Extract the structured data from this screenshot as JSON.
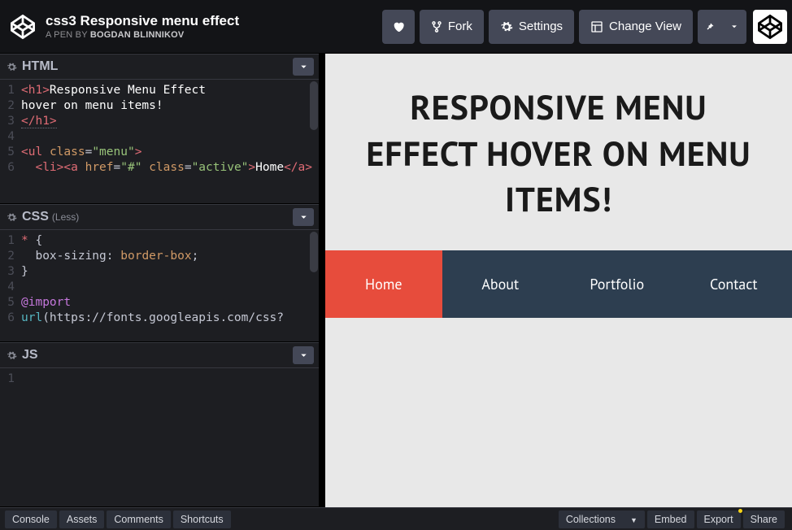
{
  "header": {
    "title": "css3 Responsive menu effect",
    "byline_prefix": "A PEN BY",
    "author": "Bogdan Blinnikov",
    "buttons": {
      "fork": "Fork",
      "settings": "Settings",
      "change_view": "Change View"
    }
  },
  "editors": {
    "html": {
      "title": "HTML",
      "lines": [
        {
          "n": "1",
          "html": "<span class='t-tag'>&lt;h1&gt;</span><span class='t-text'>Responsive Menu Effect</span>"
        },
        {
          "n": "2",
          "html": "<span class='t-text'>hover on menu items!</span>"
        },
        {
          "n": "3",
          "html": "<span class='t-tag t-close'>&lt;/h1&gt;</span>"
        },
        {
          "n": "4",
          "html": ""
        },
        {
          "n": "5",
          "html": "<span class='t-tag'>&lt;ul</span> <span class='t-attr'>class</span>=<span class='t-str'>\"menu\"</span><span class='t-tag'>&gt;</span>"
        },
        {
          "n": "6",
          "html": "  <span class='t-tag'>&lt;li&gt;&lt;a</span> <span class='t-attr'>href</span>=<span class='t-str'>\"#\"</span> <span class='t-attr'>class</span>=<span class='t-str'>\"active\"</span><span class='t-tag'>&gt;</span><span class='t-text'>Home</span><span class='t-tag'>&lt;/a&gt;</span>"
        }
      ]
    },
    "css": {
      "title": "CSS",
      "subtitle": "(Less)",
      "lines": [
        {
          "n": "1",
          "html": "<span class='t-tag'>*</span> {"
        },
        {
          "n": "2",
          "html": "  <span class='t-prop'>box-sizing</span>: <span class='t-val'>border-box</span>;"
        },
        {
          "n": "3",
          "html": "}"
        },
        {
          "n": "4",
          "html": ""
        },
        {
          "n": "5",
          "html": "<span class='t-key'>@import</span>"
        },
        {
          "n": "6",
          "html": "<span class='t-url'>url</span>(https://fonts.googleapis.com/css?"
        }
      ]
    },
    "js": {
      "title": "JS",
      "lines": [
        {
          "n": "1",
          "html": ""
        }
      ]
    }
  },
  "preview": {
    "heading": "RESPONSIVE MENU EFFECT HOVER ON MENU ITEMS!",
    "menu": [
      "Home",
      "About",
      "Portfolio",
      "Contact"
    ],
    "active_index": 0
  },
  "footer": {
    "left": [
      "Console",
      "Assets",
      "Comments",
      "Shortcuts"
    ],
    "right": [
      "Collections",
      "Embed",
      "Export",
      "Share"
    ]
  }
}
